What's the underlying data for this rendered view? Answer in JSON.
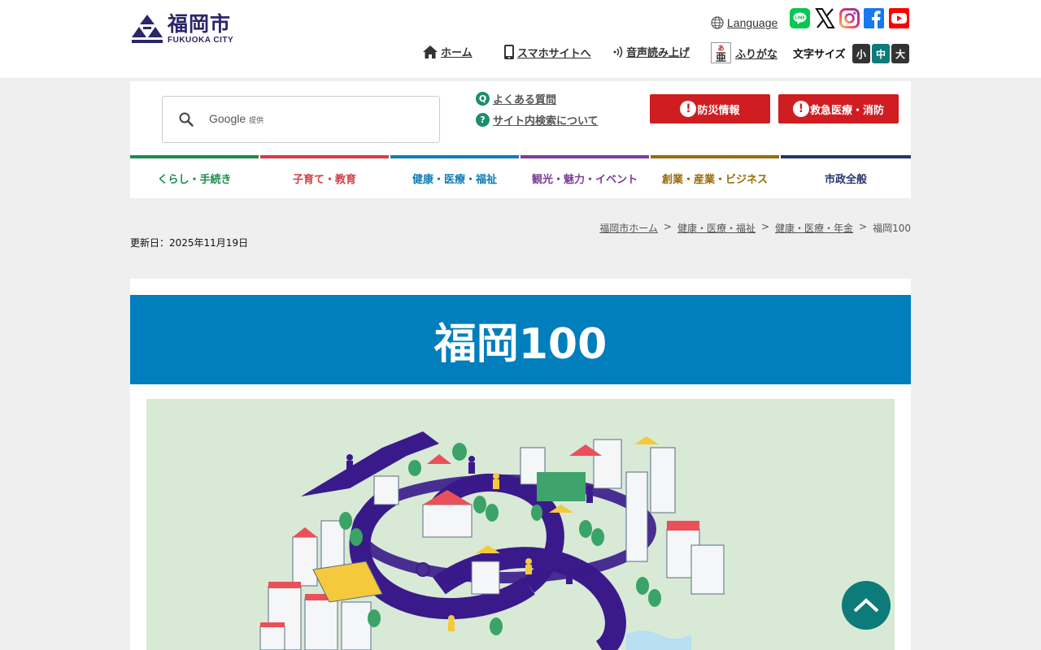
{
  "header": {
    "logo_main": "福岡市",
    "logo_sub": "FUKUOKA CITY",
    "language_label": "Language",
    "social": [
      "LINE",
      "X",
      "Instagram",
      "Facebook",
      "YouTube"
    ],
    "util_links": {
      "home": "ホーム",
      "smartphone": "スマホサイトへ",
      "voice": "音声読み上げ",
      "furigana": "ふりがな"
    },
    "font_size_label": "文字サイズ",
    "font_sizes": {
      "small": "小",
      "medium": "中",
      "large": "大"
    }
  },
  "search": {
    "google_label": "Google",
    "provided_label": "提供",
    "faq_link": "よくある質問",
    "about_search_link": "サイト内検索について",
    "faq_icon": "Q",
    "about_icon": "?"
  },
  "alerts": {
    "disaster": "防災情報",
    "emergency": "救急医療・消防"
  },
  "nav": {
    "items": [
      {
        "label": "くらし・手続き",
        "color": "#1d8c4e"
      },
      {
        "label": "子育て・教育",
        "color": "#d23e44"
      },
      {
        "label": "健康・医療・福祉",
        "color": "#0e7eb5"
      },
      {
        "label": "観光・魅力・イベント",
        "color": "#7c3c98"
      },
      {
        "label": "創業・産業・ビジネス",
        "color": "#9b6a09"
      },
      {
        "label": "市政全般",
        "color": "#24366b"
      }
    ]
  },
  "breadcrumb": {
    "items": [
      "福岡市ホーム",
      "健康・医療・福祉",
      "健康・医療・年金"
    ],
    "current": "福岡100",
    "separator": ">"
  },
  "page": {
    "updated": "更新日：2025年11月19日",
    "title": "福岡100"
  },
  "colors": {
    "accent_blue": "#017ebc",
    "alert_red": "#cf1d21",
    "logo_navy": "#2b2669",
    "page_top": "#0d7b7a"
  }
}
